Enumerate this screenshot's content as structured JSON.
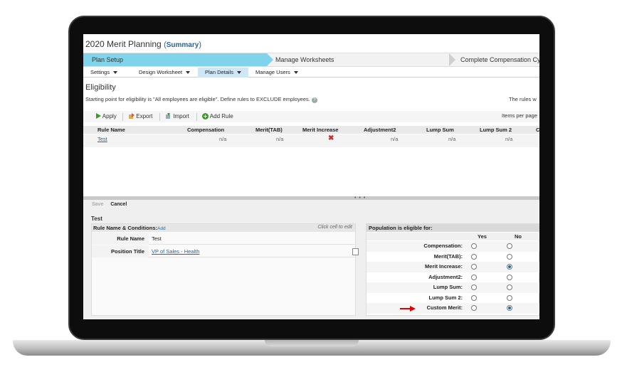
{
  "app": {
    "title": "2020 Merit Planning",
    "title_paren_open": "(",
    "title_link": "Summary",
    "title_paren_close": ")"
  },
  "steps": [
    "Plan Setup",
    "Manage Worksheets",
    "Complete Compensation Cy"
  ],
  "subtabs": [
    {
      "label": "Settings"
    },
    {
      "label": "Design Worksheet"
    },
    {
      "label": "Plan Details",
      "active": true
    },
    {
      "label": "Manage Users"
    }
  ],
  "eligibility": {
    "heading": "Eligibility",
    "description": "Starting point for eligibility is \"All employees are eligible\". Define rules to EXCLUDE employees.",
    "rules_text": "The rules w",
    "items_per_page": "Items per page"
  },
  "toolbar": {
    "apply": "Apply",
    "export": "Export",
    "import": "Import",
    "add_rule": "Add Rule"
  },
  "grid": {
    "headers": [
      "Rule Name",
      "Compensation",
      "Merit(TAB)",
      "Merit Increase",
      "Adjustment2",
      "Lump Sum",
      "Lump Sum 2",
      "C"
    ],
    "rows": [
      {
        "rule_name": "Test",
        "compensation": "n/a",
        "merit_tab": "n/a",
        "merit_increase": "x",
        "adjustment2": "n/a",
        "lump_sum": "n/a",
        "lump_sum_2": "n/a"
      }
    ]
  },
  "editor": {
    "save": "Save",
    "cancel": "Cancel",
    "rule_title": "Test",
    "left_header": "Rule Name & Conditions:",
    "add": "Add",
    "hint": "Click cell to edit",
    "fields": [
      {
        "label": "Rule Name",
        "value": "Test"
      },
      {
        "label": "Position Title",
        "value": "VP of Sales - Health"
      }
    ],
    "right_header": "Population is eligible for:",
    "col_yes": "Yes",
    "col_no": "No",
    "eligibility_items": [
      {
        "label": "Compensation:",
        "selected": "none"
      },
      {
        "label": "Merit(TAB):",
        "selected": "none"
      },
      {
        "label": "Merit Increase:",
        "selected": "no"
      },
      {
        "label": "Adjustment2:",
        "selected": "none"
      },
      {
        "label": "Lump Sum:",
        "selected": "none"
      },
      {
        "label": "Lump Sum 2:",
        "selected": "none"
      },
      {
        "label": "Custom Merit:",
        "selected": "no"
      }
    ]
  },
  "colors": {
    "accent": "#7fd3ea",
    "link": "#1f67a8",
    "error": "#d62828",
    "arrow": "#e00000"
  },
  "icons": [
    "apply-icon",
    "export-icon",
    "import-icon",
    "add-rule-icon",
    "help-icon",
    "delete-icon",
    "red-x-icon",
    "red-arrow-icon"
  ]
}
